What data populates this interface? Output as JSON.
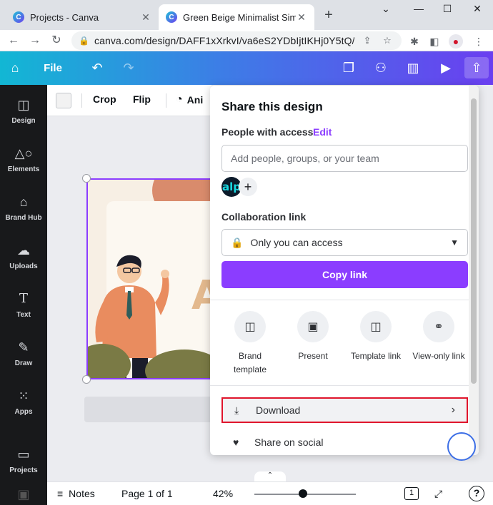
{
  "browser": {
    "tabs": [
      {
        "title": "Projects - Canva",
        "active": false
      },
      {
        "title": "Green Beige Minimalist Simple",
        "active": true
      }
    ],
    "url": "canva.com/design/DAFF1xXrkvI/va6eS2YDbIjtIKHj0Y5tQ/edit",
    "window_controls": {
      "minimize": "⌄",
      "restore": "—",
      "maximize": "☐",
      "close": "✕"
    }
  },
  "header": {
    "file_label": "File"
  },
  "sidebar": {
    "items": [
      {
        "label": "Design",
        "icon": "design-icon"
      },
      {
        "label": "Elements",
        "icon": "elements-icon"
      },
      {
        "label": "Brand Hub",
        "icon": "brand-hub-icon"
      },
      {
        "label": "Uploads",
        "icon": "uploads-icon"
      },
      {
        "label": "Text",
        "icon": "text-icon"
      },
      {
        "label": "Draw",
        "icon": "draw-icon"
      },
      {
        "label": "Apps",
        "icon": "apps-icon"
      },
      {
        "label": "Projects",
        "icon": "projects-icon"
      }
    ]
  },
  "context_toolbar": {
    "crop": "Crop",
    "flip": "Flip",
    "animate": "Ani"
  },
  "design": {
    "letter": "A"
  },
  "share_panel": {
    "title": "Share this design",
    "people_label": "People with access",
    "edit_link": "Edit",
    "people_placeholder": "Add people, groups, or your team",
    "avatar_initials": "alp",
    "collab_label": "Collaboration link",
    "access_value": "Only you can access",
    "copy_link": "Copy link",
    "options": [
      {
        "label": "Brand template",
        "icon": "brand-template-icon"
      },
      {
        "label": "Present",
        "icon": "present-icon"
      },
      {
        "label": "Template link",
        "icon": "template-link-icon"
      },
      {
        "label": "View-only link",
        "icon": "view-only-link-icon"
      }
    ],
    "download": "Download",
    "share_social": "Share on social"
  },
  "bottom_bar": {
    "notes": "Notes",
    "page_indicator": "Page 1 of 1",
    "zoom": "42%",
    "page_count": "1",
    "help": "?"
  },
  "colors": {
    "accent": "#8b3dff",
    "header_start": "#12b7d4",
    "header_end": "#6a3ff0",
    "highlight_border": "#e0152c"
  }
}
